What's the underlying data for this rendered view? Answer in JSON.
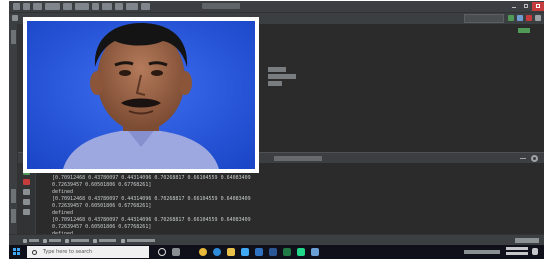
{
  "console": {
    "lines": [
      "[0.70912468 0.43780097 0.44314096 0.70268817 0.66104559 0.64083409",
      " 0.72639457 0.60501806 0.67768261]",
      "defined",
      "[0.70912468 0.43780097 0.44314096 0.70268817 0.66104559 0.64083409",
      " 0.72639457 0.60501806 0.67768261]",
      "defined",
      "[0.70912468 0.43780097 0.44314096 0.70268817 0.66104559 0.64083409",
      " 0.72639457 0.60501806 0.67768261]",
      "defined"
    ]
  },
  "taskbar": {
    "search_placeholder": "Type here to search"
  },
  "colors": {
    "ide_background": "#2b2b2b",
    "panel": "#3c3f41",
    "taskbar": "#10101a",
    "photo_background": "#1d4fd9",
    "close_button": "#c63b3b",
    "accent_green": "#4e9a56"
  },
  "icons": [
    "windows-start-icon",
    "search-icon",
    "gear-icon",
    "run-icon",
    "stop-icon",
    "rerun-icon",
    "close-icon",
    "minimize-icon",
    "maximize-icon"
  ]
}
